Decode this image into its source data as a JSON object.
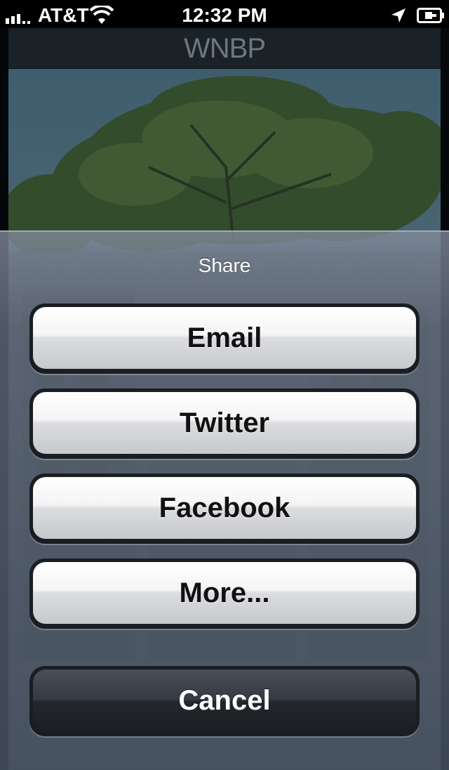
{
  "status_bar": {
    "carrier": "AT&T",
    "time": "12:32 PM",
    "signal_icon": "signal-bars-icon",
    "wifi_icon": "wifi-icon",
    "location_icon": "location-arrow-icon",
    "battery_icon": "battery-charging-icon"
  },
  "app": {
    "title": "WNBP"
  },
  "action_sheet": {
    "title": "Share",
    "buttons": [
      "Email",
      "Twitter",
      "Facebook",
      "More..."
    ],
    "cancel_label": "Cancel"
  },
  "colors": {
    "sheet_tint": "#5f6978",
    "button_light": "#f4f4f5",
    "button_dark": "#23262c"
  }
}
